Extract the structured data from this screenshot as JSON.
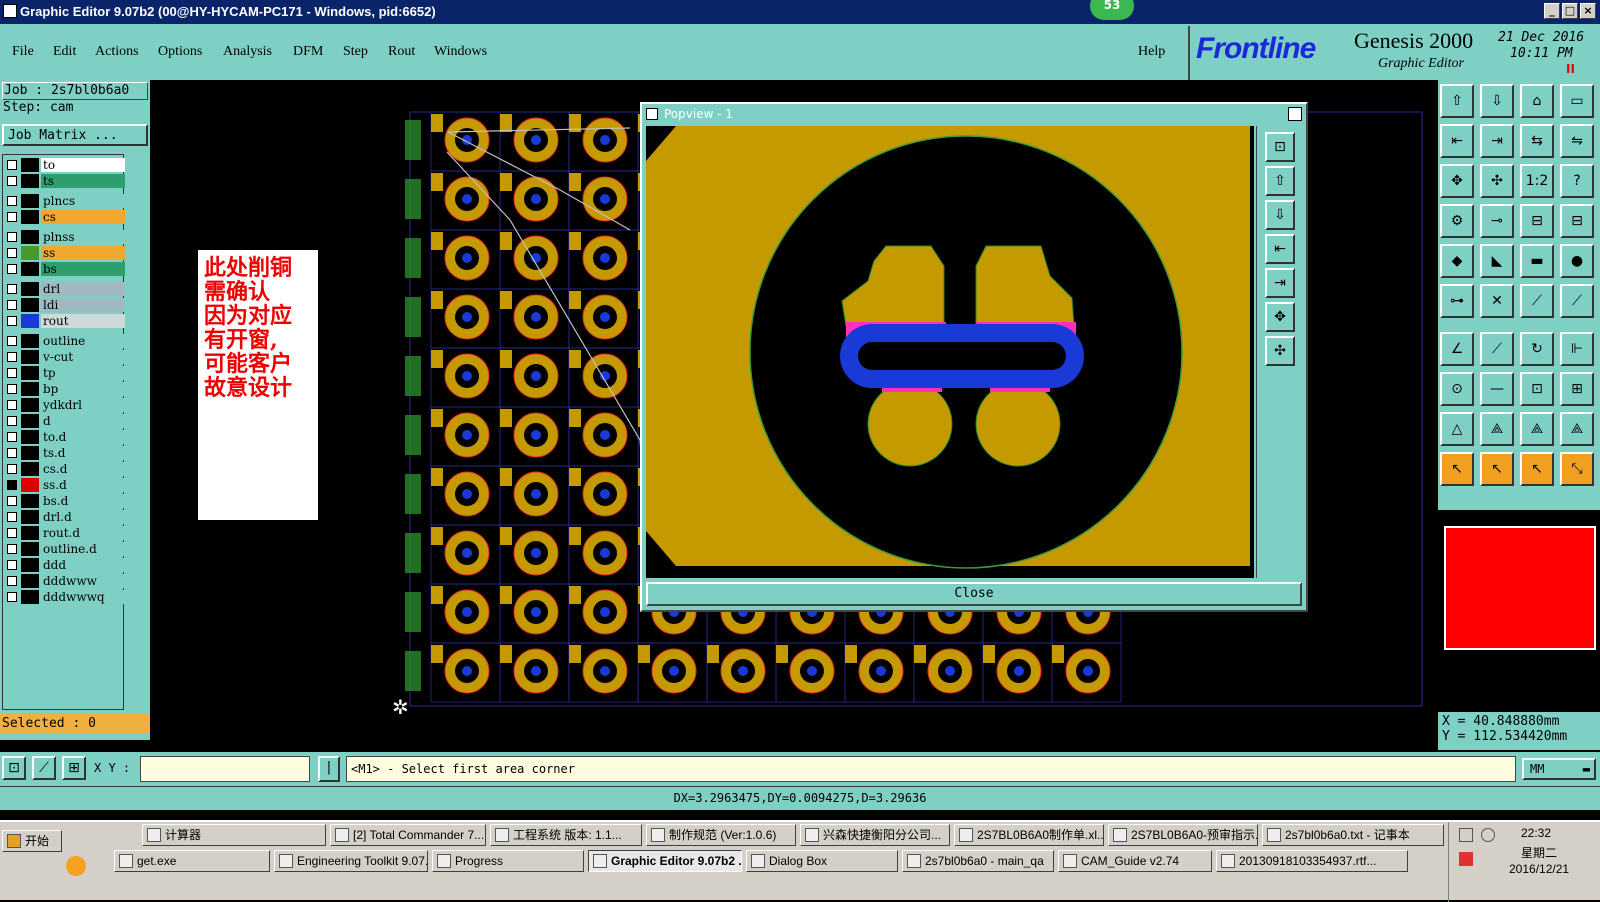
{
  "window": {
    "title": "Graphic Editor 9.07b2 (00@HY-HYCAM-PC171 - Windows, pid:6652)",
    "badge": "53"
  },
  "menu": [
    "File",
    "Edit",
    "Actions",
    "Options",
    "Analysis",
    "DFM",
    "Step",
    "Rout",
    "Windows"
  ],
  "help": "Help",
  "brand": {
    "logo": "Frontline",
    "product": "Genesis 2000",
    "subtitle": "Graphic Editor",
    "date": "21 Dec 2016",
    "time": "10:11 PM",
    "pause": "II"
  },
  "job": {
    "job_line": "Job : 2s7bl0b6a0",
    "step_line": "Step: cam",
    "matrix_button": "Job Matrix ..."
  },
  "layers": [
    {
      "name": "to",
      "color": "#ffffff",
      "swatch": "#000000",
      "checked": false
    },
    {
      "name": "ts",
      "color": "#2e9e6e",
      "swatch": "#000000",
      "checked": false
    },
    {
      "name": "plncs",
      "color": "#7ecfc4",
      "swatch": "#000000",
      "checked": false
    },
    {
      "name": "cs",
      "color": "#f0a830",
      "swatch": "#000000",
      "checked": false
    },
    {
      "name": "plnss",
      "color": "#7ecfc4",
      "swatch": "#000000",
      "checked": false
    },
    {
      "name": "ss",
      "color": "#f0a830",
      "swatch": "#4a9a2a",
      "checked": false
    },
    {
      "name": "bs",
      "color": "#2e9e6e",
      "swatch": "#000000",
      "checked": false
    },
    {
      "name": "drl",
      "color": "#a0b8c0",
      "swatch": "#000000",
      "checked": false
    },
    {
      "name": "ldi",
      "color": "#a0b8c0",
      "swatch": "#000000",
      "checked": false
    },
    {
      "name": "rout",
      "color": "#d0d8d8",
      "swatch": "#1a3ad8",
      "checked": false
    },
    {
      "name": "outline",
      "color": "#7ecfc4",
      "swatch": "#000000",
      "checked": false
    },
    {
      "name": "v-cut",
      "color": "#7ecfc4",
      "swatch": "#000000",
      "checked": false
    },
    {
      "name": "tp",
      "color": "#7ecfc4",
      "swatch": "#000000",
      "checked": false
    },
    {
      "name": "bp",
      "color": "#7ecfc4",
      "swatch": "#000000",
      "checked": false
    },
    {
      "name": "ydkdrl",
      "color": "#7ecfc4",
      "swatch": "#000000",
      "checked": false
    },
    {
      "name": "d",
      "color": "#7ecfc4",
      "swatch": "#000000",
      "checked": false
    },
    {
      "name": "to.d",
      "color": "#7ecfc4",
      "swatch": "#000000",
      "checked": false
    },
    {
      "name": "ts.d",
      "color": "#7ecfc4",
      "swatch": "#000000",
      "checked": false
    },
    {
      "name": "cs.d",
      "color": "#7ecfc4",
      "swatch": "#000000",
      "checked": false
    },
    {
      "name": "ss.d",
      "color": "#7ecfc4",
      "swatch": "#e00000",
      "checked": true
    },
    {
      "name": "bs.d",
      "color": "#7ecfc4",
      "swatch": "#000000",
      "checked": false
    },
    {
      "name": "drl.d",
      "color": "#7ecfc4",
      "swatch": "#000000",
      "checked": false
    },
    {
      "name": "rout.d",
      "color": "#7ecfc4",
      "swatch": "#000000",
      "checked": false
    },
    {
      "name": "outline.d",
      "color": "#7ecfc4",
      "swatch": "#000000",
      "checked": false
    },
    {
      "name": "ddd",
      "color": "#7ecfc4",
      "swatch": "#000000",
      "checked": false
    },
    {
      "name": "dddwww",
      "color": "#7ecfc4",
      "swatch": "#000000",
      "checked": false
    },
    {
      "name": "dddwwwq",
      "color": "#7ecfc4",
      "swatch": "#000000",
      "checked": false
    }
  ],
  "selected_label": "Selected : 0",
  "note_lines": [
    "此处削铜",
    "需确认",
    "因为对应",
    "有开窗,",
    "可能客户",
    "故意设计"
  ],
  "popview": {
    "title": "Popview - 1",
    "close_button": "Close"
  },
  "coords": {
    "x": "X  =  40.848880mm",
    "y": "Y  =  112.534420mm"
  },
  "cmd": {
    "xy_label": "X Y :",
    "xy_value": "",
    "prompt": "<M1> - Select first area corner",
    "units": "MM"
  },
  "status": "DX=3.2963475,DY=0.0094275,D=3.29636",
  "taskbar": {
    "start": "开始",
    "row1": [
      "计算器",
      "[2] Total Commander 7...",
      "工程系统  版本: 1.1...",
      "制作规范 (Ver:1.0.6)",
      "兴森快捷衡阳分公司...",
      "2S7BL0B6A0制作单.xl...",
      "2S7BL0B6A0-预审指示...",
      "2s7bl0b6a0.txt - 记事本"
    ],
    "row2": [
      "get.exe",
      "Engineering Toolkit 9.07...",
      "Progress",
      "Graphic Editor 9.07b2 ...",
      "Dialog Box",
      "2s7bl0b6a0 - main_qa",
      "CAM_Guide v2.74",
      "20130918103354937.rtf..."
    ],
    "active": "Graphic Editor 9.07b2 ...",
    "clock_time": "22:32",
    "clock_day": "星期二",
    "clock_date": "2016/12/21"
  },
  "colors": {
    "teal": "#7ecfc4",
    "copper": "#c8a000",
    "blue": "#1a3ad8",
    "pink": "#ff30c0",
    "red": "#ff0000"
  }
}
